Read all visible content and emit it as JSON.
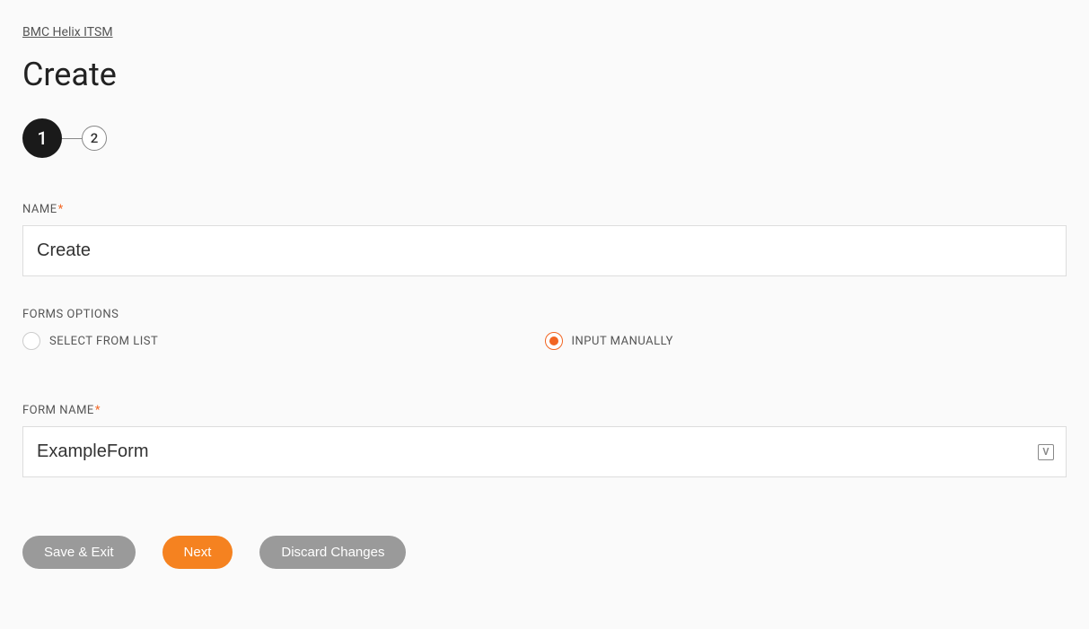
{
  "breadcrumb": "BMC Helix ITSM",
  "page_title": "Create",
  "stepper": {
    "steps": [
      "1",
      "2"
    ],
    "active_index": 0
  },
  "fields": {
    "name": {
      "label": "NAME",
      "required": true,
      "value": "Create"
    },
    "forms_options": {
      "label": "FORMS OPTIONS",
      "options": [
        {
          "label": "SELECT FROM LIST",
          "selected": false
        },
        {
          "label": "INPUT MANUALLY",
          "selected": true
        }
      ]
    },
    "form_name": {
      "label": "FORM NAME",
      "required": true,
      "value": "ExampleForm",
      "suffix_icon_glyph": "V"
    }
  },
  "buttons": {
    "save_exit": "Save & Exit",
    "next": "Next",
    "discard": "Discard Changes"
  },
  "required_mark": "*"
}
